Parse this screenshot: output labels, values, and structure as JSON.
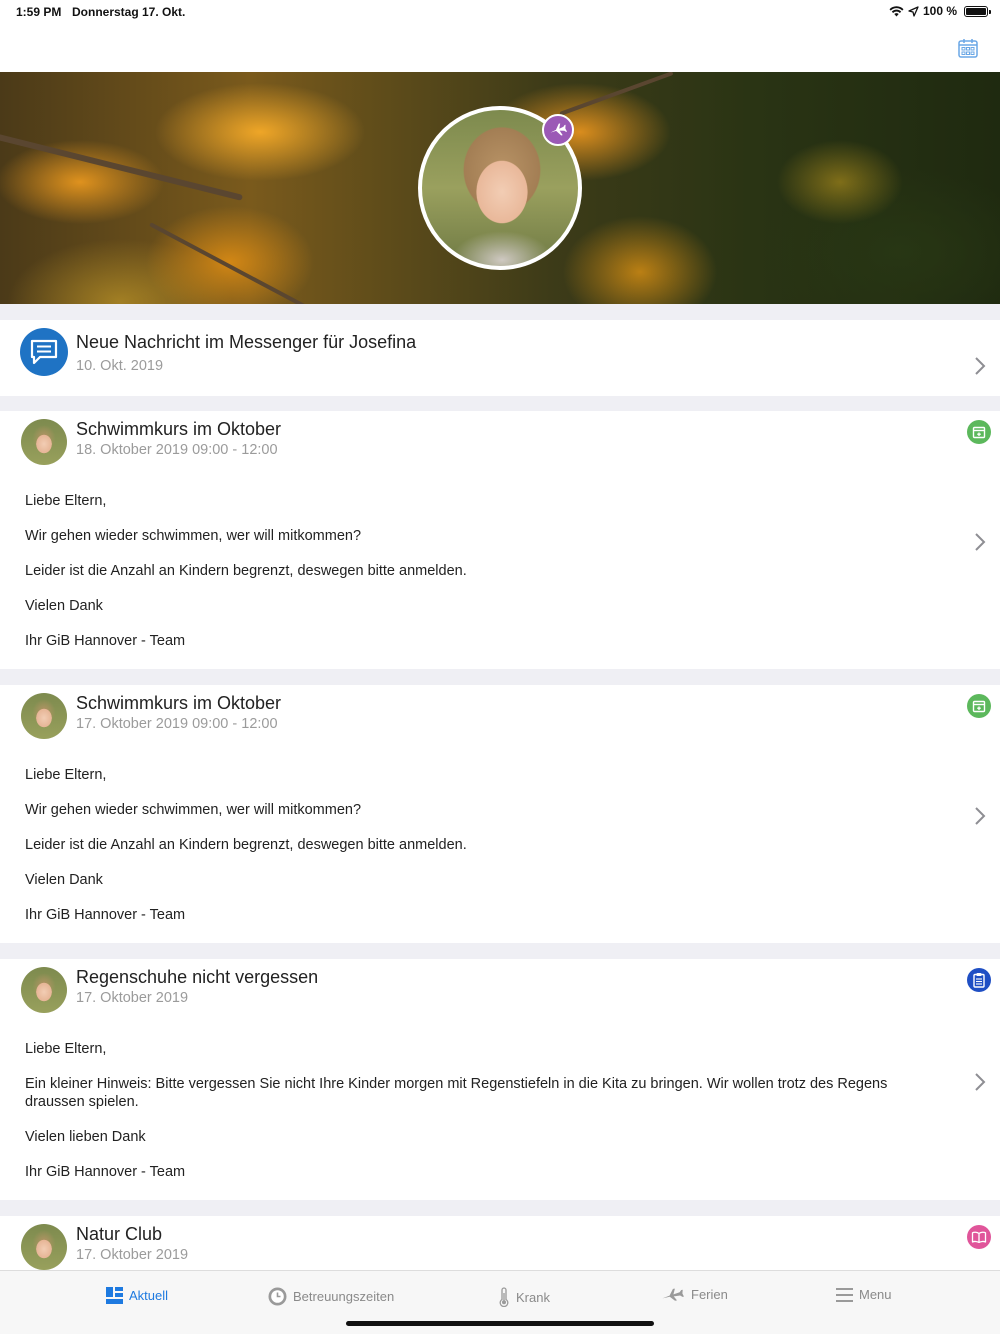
{
  "status_bar": {
    "time": "1:59 PM",
    "date": "Donnerstag 17. Okt.",
    "battery": "100 %"
  },
  "notification": {
    "title": "Neue Nachricht im Messenger für Josefina",
    "date": "10. Okt. 2019",
    "icon": "chat-bubble-icon"
  },
  "posts": [
    {
      "title": "Schwimmkurs im Oktober",
      "date": "18. Oktober 2019 09:00 - 12:00",
      "icon": "calendar-icon",
      "icon_color": "#5cb85c",
      "body": [
        "Liebe Eltern,",
        "Wir gehen wieder schwimmen, wer will mitkommen?",
        "Leider ist die Anzahl an Kindern begrenzt,  deswegen bitte anmelden.",
        "Vielen Dank",
        "Ihr GiB Hannover - Team"
      ]
    },
    {
      "title": "Schwimmkurs im Oktober",
      "date": "17. Oktober 2019 09:00 - 12:00",
      "icon": "calendar-icon",
      "icon_color": "#5cb85c",
      "body": [
        "Liebe Eltern,",
        "Wir gehen wieder schwimmen, wer will mitkommen?",
        "Leider ist die Anzahl an Kindern begrenzt,  deswegen bitte anmelden.",
        "Vielen Dank",
        "Ihr GiB Hannover - Team"
      ]
    },
    {
      "title": "Regenschuhe nicht vergessen",
      "date": "17. Oktober 2019",
      "icon": "clipboard-icon",
      "icon_color": "#1f4fc4",
      "body": [
        "Liebe Eltern,",
        "Ein kleiner Hinweis: Bitte vergessen Sie nicht Ihre Kinder morgen mit Regenstiefeln  in die Kita zu bringen. Wir wollen trotz des Regens draussen spielen.",
        "Vielen lieben Dank",
        "Ihr GiB Hannover - Team"
      ]
    },
    {
      "title": "Natur Club",
      "date": "17. Oktober 2019",
      "icon": "book-icon",
      "icon_color": "#e0559a",
      "body": []
    }
  ],
  "tabs": [
    {
      "label": "Aktuell",
      "icon": "dashboard-icon",
      "active": true
    },
    {
      "label": "Betreuungszeiten",
      "icon": "clock-icon",
      "active": false
    },
    {
      "label": "Krank",
      "icon": "thermometer-icon",
      "active": false
    },
    {
      "label": "Ferien",
      "icon": "airplane-icon",
      "active": false
    },
    {
      "label": "Menu",
      "icon": "hamburger-icon",
      "active": false
    }
  ],
  "colors": {
    "accent": "#1e7ae0",
    "vacation_badge": "#9b59b6",
    "messenger": "#1f73c4"
  }
}
